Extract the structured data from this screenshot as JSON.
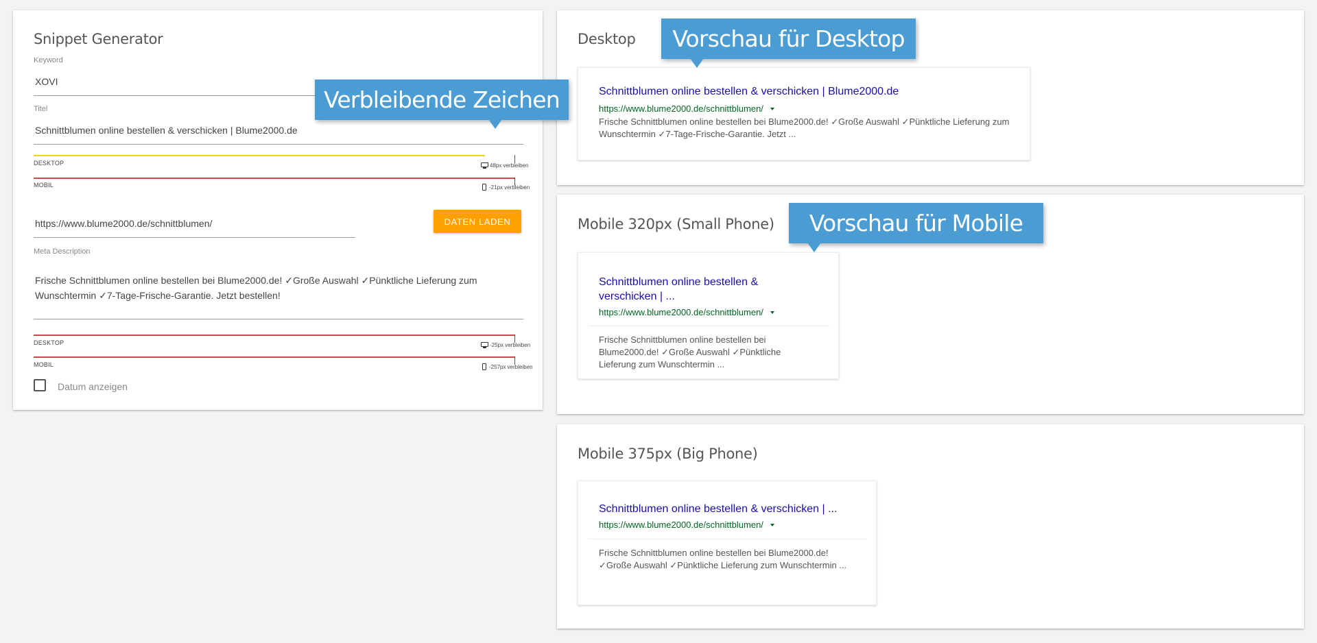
{
  "generator": {
    "title": "Snippet Generator",
    "keyword_label": "Keyword",
    "keyword_value": "XOVI",
    "title_label": "Titel",
    "title_value": "Schnittblumen online bestellen & verschicken | Blume2000.de",
    "title_meter": {
      "desktop_label": "DESKTOP",
      "desktop_remaining": "48px verbleiben",
      "mobile_label": "MOBIL",
      "mobile_remaining": "-21px verbleiben",
      "desktop_color": "#f2d21b",
      "mobile_color": "#c94b4b"
    },
    "url_value": "https://www.blume2000.de/schnittblumen/",
    "load_button": "DATEN LADEN",
    "meta_label": "Meta Description",
    "meta_value": "Frische Schnittblumen online bestellen bei Blume2000.de! ✓Große Auswahl ✓Pünktliche Lieferung zum Wunschtermin ✓7-Tage-Frische-Garantie. Jetzt bestellen!",
    "meta_meter": {
      "desktop_label": "DESKTOP",
      "desktop_remaining": "-25px verbleiben",
      "mobile_label": "MOBIL",
      "mobile_remaining": "-257px verbleiben",
      "desktop_color": "#c94b4b",
      "mobile_color": "#c94b4b"
    },
    "show_date_label": "Datum anzeigen",
    "show_date_checked": false
  },
  "desktop_preview": {
    "title": "Desktop",
    "serp_title": "Schnittblumen online bestellen & verschicken | Blume2000.de",
    "serp_url": "https://www.blume2000.de/schnittblumen/",
    "serp_desc": "Frische Schnittblumen online bestellen bei Blume2000.de! ✓Große Auswahl ✓Pünktliche Lieferung zum Wunschtermin ✓7-Tage-Frische-Garantie. Jetzt ..."
  },
  "small_phone_preview": {
    "title": "Mobile 320px (Small Phone)",
    "serp_title": "Schnittblumen online bestellen & verschicken | ...",
    "serp_url": "https://www.blume2000.de/schnittblumen/",
    "serp_desc": "Frische Schnittblumen online bestellen bei Blume2000.de! ✓Große Auswahl ✓Pünktliche Lieferung zum Wunschtermin ..."
  },
  "big_phone_preview": {
    "title": "Mobile 375px (Big Phone)",
    "serp_title": "Schnittblumen online bestellen & verschicken | ...",
    "serp_url": "https://www.blume2000.de/schnittblumen/",
    "serp_desc": "Frische Schnittblumen online bestellen bei Blume2000.de! ✓Große Auswahl ✓Pünktliche Lieferung zum Wunschtermin ..."
  },
  "callouts": {
    "remaining_chars": "Verbleibende Zeichen",
    "desktop_preview": "Vorschau für Desktop",
    "mobile_preview": "Vorschau für Mobile",
    "color": "#4b9cd3"
  }
}
